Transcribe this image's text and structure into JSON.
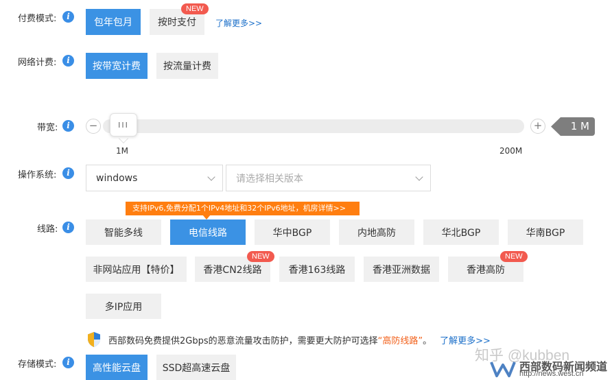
{
  "payment": {
    "label": "付费模式:",
    "options": [
      "包年包月",
      "按时支付"
    ],
    "new_badge": "NEW",
    "learn_more": "了解更多>>"
  },
  "network": {
    "label": "网络计费:",
    "options": [
      "按带宽计费",
      "按流量计费"
    ]
  },
  "bandwidth": {
    "label": "带宽:",
    "minus": "−",
    "plus": "+",
    "thumb_grip": "III",
    "min_label": "1M",
    "max_label": "200M",
    "value": "1 M",
    "current_mb": 1,
    "min_mb": 1,
    "max_mb": 200
  },
  "os": {
    "label": "操作系统:",
    "selected": "windows",
    "version_placeholder": "请选择相关版本"
  },
  "line": {
    "label": "线路:",
    "tooltip": "支持IPv6,免费分配1个IPv4地址和32个IPv6地址，机房详情>>",
    "options": [
      "智能多线",
      "电信线路",
      "华中BGP",
      "内地高防",
      "华北BGP",
      "华南BGP",
      "非网站应用【特价】",
      "香港CN2线路",
      "香港163线路",
      "香港亚洲数据",
      "香港高防",
      "多IP应用"
    ],
    "new_badge": "NEW",
    "note_prefix": "西部数码免费提供2Gbps的恶意流量攻击防护，需要更大防护可选择",
    "note_highlight": "“高防线路”",
    "note_suffix": "。",
    "note_link": "了解更多>>"
  },
  "storage": {
    "label": "存储模式:",
    "options": [
      "高性能云盘",
      "SSD超高速云盘"
    ]
  },
  "watermark": {
    "zhihu": "知乎 @kubben",
    "brand": "西部数码新闻频道",
    "url": "http://news.west.cn"
  },
  "colors": {
    "accent": "#3b92e4",
    "badge": "#f25a4f",
    "tooltip": "#ff7e10",
    "link": "#1b6fc9"
  },
  "icons": [
    "info-icon",
    "shield-icon",
    "chevron-down-icon",
    "minus-icon",
    "plus-icon"
  ]
}
